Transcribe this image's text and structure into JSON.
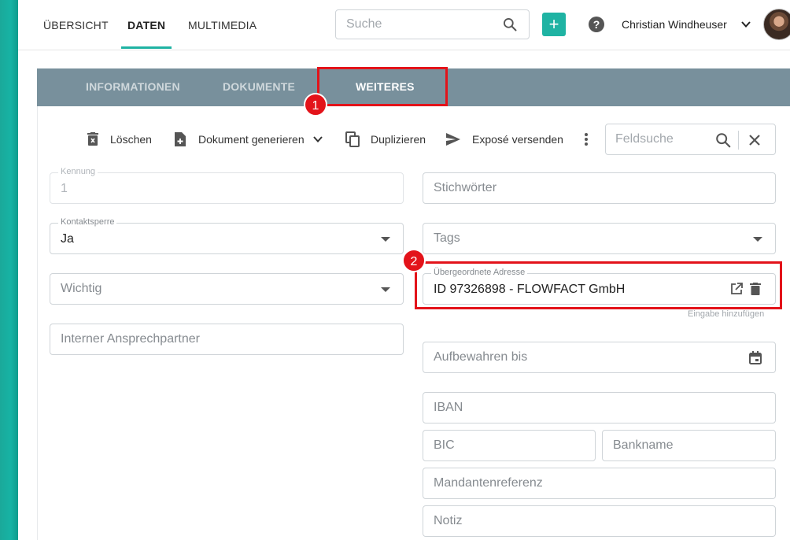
{
  "topnav": {
    "tabs": [
      {
        "label": "ÜBERSICHT"
      },
      {
        "label": "DATEN",
        "active": true
      },
      {
        "label": "MULTIMEDIA"
      }
    ],
    "search_placeholder": "Suche",
    "add_icon": "plus-icon",
    "help_icon": "question-icon",
    "user_name": "Christian Windheuser",
    "accent_color": "#1fb3a3"
  },
  "subtabs": [
    {
      "label": "INFORMATIONEN"
    },
    {
      "label": "DOKUMENTE"
    },
    {
      "label": "WEITERES",
      "active": true
    }
  ],
  "annotations": {
    "badge1": "1",
    "badge2": "2",
    "color": "#e3131a"
  },
  "actions": {
    "delete": "Löschen",
    "generate": "Dokument generieren",
    "duplicate": "Duplizieren",
    "send": "Exposé versenden",
    "fieldsearch_placeholder": "Feldsuche"
  },
  "left_fields": {
    "kennung_label": "Kennung",
    "kennung_value": "1",
    "kontaktsperre_label": "Kontaktsperre",
    "kontaktsperre_value": "Ja",
    "wichtig_placeholder": "Wichtig",
    "ansprechpartner_placeholder": "Interner Ansprechpartner"
  },
  "right_fields": {
    "stichwoerter_placeholder": "Stichwörter",
    "tags_placeholder": "Tags",
    "adresse_label": "Übergeordnete Adresse",
    "adresse_value": "ID 97326898 - FLOWFACT GmbH",
    "add_hint": "Eingabe hinzufügen",
    "aufbewahren_placeholder": "Aufbewahren bis",
    "iban_placeholder": "IBAN",
    "bic_placeholder": "BIC",
    "bankname_placeholder": "Bankname",
    "mandantenreferenz_placeholder": "Mandantenreferenz",
    "notiz_placeholder": "Notiz"
  }
}
